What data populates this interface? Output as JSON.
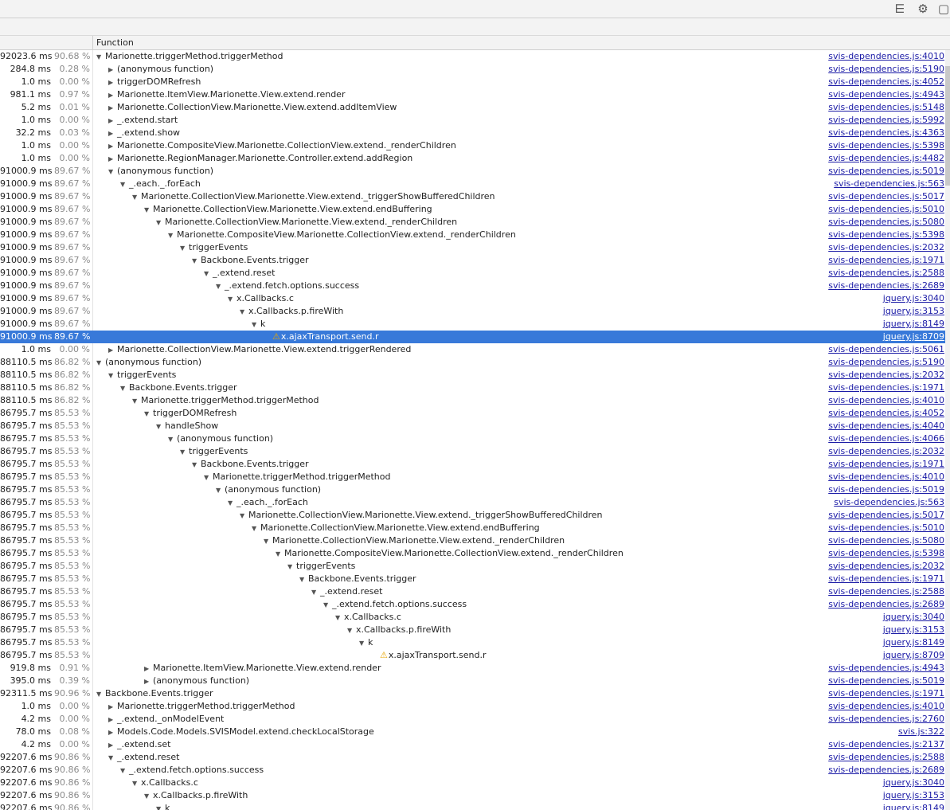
{
  "toolbar": {
    "icons": [
      "list-icon",
      "gear-icon",
      "dock-icon"
    ],
    "glyphs": [
      "⋿",
      "⚙",
      "▢"
    ]
  },
  "columns": {
    "function": "Function"
  },
  "rows": [
    {
      "self": "92023.6 ms",
      "pct": "90.68 %",
      "depth": 0,
      "expander": "open",
      "name": "Marionette.triggerMethod.triggerMethod",
      "url": "svis-dependencies.js:4010"
    },
    {
      "self": "284.8 ms",
      "pct": "0.28 %",
      "depth": 1,
      "expander": "closed",
      "name": "(anonymous function)",
      "url": "svis-dependencies.js:5190"
    },
    {
      "self": "1.0 ms",
      "pct": "0.00 %",
      "depth": 1,
      "expander": "closed",
      "name": "triggerDOMRefresh",
      "url": "svis-dependencies.js:4052"
    },
    {
      "self": "981.1 ms",
      "pct": "0.97 %",
      "depth": 1,
      "expander": "closed",
      "name": "Marionette.ItemView.Marionette.View.extend.render",
      "url": "svis-dependencies.js:4943"
    },
    {
      "self": "5.2 ms",
      "pct": "0.01 %",
      "depth": 1,
      "expander": "closed",
      "name": "Marionette.CollectionView.Marionette.View.extend.addItemView",
      "url": "svis-dependencies.js:5148"
    },
    {
      "self": "1.0 ms",
      "pct": "0.00 %",
      "depth": 1,
      "expander": "closed",
      "name": "_.extend.start",
      "url": "svis-dependencies.js:5992"
    },
    {
      "self": "32.2 ms",
      "pct": "0.03 %",
      "depth": 1,
      "expander": "closed",
      "name": "_.extend.show",
      "url": "svis-dependencies.js:4363"
    },
    {
      "self": "1.0 ms",
      "pct": "0.00 %",
      "depth": 1,
      "expander": "closed",
      "name": "Marionette.CompositeView.Marionette.CollectionView.extend._renderChildren",
      "url": "svis-dependencies.js:5398"
    },
    {
      "self": "1.0 ms",
      "pct": "0.00 %",
      "depth": 1,
      "expander": "closed",
      "name": "Marionette.RegionManager.Marionette.Controller.extend.addRegion",
      "url": "svis-dependencies.js:4482"
    },
    {
      "self": "91000.9 ms",
      "pct": "89.67 %",
      "depth": 1,
      "expander": "open",
      "name": "(anonymous function)",
      "url": "svis-dependencies.js:5019"
    },
    {
      "self": "91000.9 ms",
      "pct": "89.67 %",
      "depth": 2,
      "expander": "open",
      "name": "_.each._.forEach",
      "url": "svis-dependencies.js:563"
    },
    {
      "self": "91000.9 ms",
      "pct": "89.67 %",
      "depth": 3,
      "expander": "open",
      "name": "Marionette.CollectionView.Marionette.View.extend._triggerShowBufferedChildren",
      "url": "svis-dependencies.js:5017"
    },
    {
      "self": "91000.9 ms",
      "pct": "89.67 %",
      "depth": 4,
      "expander": "open",
      "name": "Marionette.CollectionView.Marionette.View.extend.endBuffering",
      "url": "svis-dependencies.js:5010"
    },
    {
      "self": "91000.9 ms",
      "pct": "89.67 %",
      "depth": 5,
      "expander": "open",
      "name": "Marionette.CollectionView.Marionette.View.extend._renderChildren",
      "url": "svis-dependencies.js:5080"
    },
    {
      "self": "91000.9 ms",
      "pct": "89.67 %",
      "depth": 6,
      "expander": "open",
      "name": "Marionette.CompositeView.Marionette.CollectionView.extend._renderChildren",
      "url": "svis-dependencies.js:5398"
    },
    {
      "self": "91000.9 ms",
      "pct": "89.67 %",
      "depth": 7,
      "expander": "open",
      "name": "triggerEvents",
      "url": "svis-dependencies.js:2032"
    },
    {
      "self": "91000.9 ms",
      "pct": "89.67 %",
      "depth": 8,
      "expander": "open",
      "name": "Backbone.Events.trigger",
      "url": "svis-dependencies.js:1971"
    },
    {
      "self": "91000.9 ms",
      "pct": "89.67 %",
      "depth": 9,
      "expander": "open",
      "name": "_.extend.reset",
      "url": "svis-dependencies.js:2588"
    },
    {
      "self": "91000.9 ms",
      "pct": "89.67 %",
      "depth": 10,
      "expander": "open",
      "name": "_.extend.fetch.options.success",
      "url": "svis-dependencies.js:2689"
    },
    {
      "self": "91000.9 ms",
      "pct": "89.67 %",
      "depth": 11,
      "expander": "open",
      "name": "x.Callbacks.c",
      "url": "jquery.js:3040"
    },
    {
      "self": "91000.9 ms",
      "pct": "89.67 %",
      "depth": 12,
      "expander": "open",
      "name": "x.Callbacks.p.fireWith",
      "url": "jquery.js:3153"
    },
    {
      "self": "91000.9 ms",
      "pct": "89.67 %",
      "depth": 13,
      "expander": "open",
      "name": "k",
      "url": "jquery.js:8149"
    },
    {
      "self": "91000.9 ms",
      "pct": "89.67 %",
      "depth": 14,
      "expander": "none",
      "warn": true,
      "selected": true,
      "name": "x.ajaxTransport.send.r",
      "url": "jquery.js:8709"
    },
    {
      "self": "1.0 ms",
      "pct": "0.00 %",
      "depth": 1,
      "expander": "closed",
      "name": "Marionette.CollectionView.Marionette.View.extend.triggerRendered",
      "url": "svis-dependencies.js:5061"
    },
    {
      "self": "88110.5 ms",
      "pct": "86.82 %",
      "depth": 0,
      "expander": "open",
      "name": "(anonymous function)",
      "url": "svis-dependencies.js:5190"
    },
    {
      "self": "88110.5 ms",
      "pct": "86.82 %",
      "depth": 1,
      "expander": "open",
      "name": "triggerEvents",
      "url": "svis-dependencies.js:2032"
    },
    {
      "self": "88110.5 ms",
      "pct": "86.82 %",
      "depth": 2,
      "expander": "open",
      "name": "Backbone.Events.trigger",
      "url": "svis-dependencies.js:1971"
    },
    {
      "self": "88110.5 ms",
      "pct": "86.82 %",
      "depth": 3,
      "expander": "open",
      "name": "Marionette.triggerMethod.triggerMethod",
      "url": "svis-dependencies.js:4010"
    },
    {
      "self": "86795.7 ms",
      "pct": "85.53 %",
      "depth": 4,
      "expander": "open",
      "name": "triggerDOMRefresh",
      "url": "svis-dependencies.js:4052"
    },
    {
      "self": "86795.7 ms",
      "pct": "85.53 %",
      "depth": 5,
      "expander": "open",
      "name": "handleShow",
      "url": "svis-dependencies.js:4040"
    },
    {
      "self": "86795.7 ms",
      "pct": "85.53 %",
      "depth": 6,
      "expander": "open",
      "name": "(anonymous function)",
      "url": "svis-dependencies.js:4066"
    },
    {
      "self": "86795.7 ms",
      "pct": "85.53 %",
      "depth": 7,
      "expander": "open",
      "name": "triggerEvents",
      "url": "svis-dependencies.js:2032"
    },
    {
      "self": "86795.7 ms",
      "pct": "85.53 %",
      "depth": 8,
      "expander": "open",
      "name": "Backbone.Events.trigger",
      "url": "svis-dependencies.js:1971"
    },
    {
      "self": "86795.7 ms",
      "pct": "85.53 %",
      "depth": 9,
      "expander": "open",
      "name": "Marionette.triggerMethod.triggerMethod",
      "url": "svis-dependencies.js:4010"
    },
    {
      "self": "86795.7 ms",
      "pct": "85.53 %",
      "depth": 10,
      "expander": "open",
      "name": "(anonymous function)",
      "url": "svis-dependencies.js:5019"
    },
    {
      "self": "86795.7 ms",
      "pct": "85.53 %",
      "depth": 11,
      "expander": "open",
      "name": "_.each._.forEach",
      "url": "svis-dependencies.js:563"
    },
    {
      "self": "86795.7 ms",
      "pct": "85.53 %",
      "depth": 12,
      "expander": "open",
      "name": "Marionette.CollectionView.Marionette.View.extend._triggerShowBufferedChildren",
      "url": "svis-dependencies.js:5017"
    },
    {
      "self": "86795.7 ms",
      "pct": "85.53 %",
      "depth": 13,
      "expander": "open",
      "name": "Marionette.CollectionView.Marionette.View.extend.endBuffering",
      "url": "svis-dependencies.js:5010"
    },
    {
      "self": "86795.7 ms",
      "pct": "85.53 %",
      "depth": 14,
      "expander": "open",
      "name": "Marionette.CollectionView.Marionette.View.extend._renderChildren",
      "url": "svis-dependencies.js:5080"
    },
    {
      "self": "86795.7 ms",
      "pct": "85.53 %",
      "depth": 15,
      "expander": "open",
      "name": "Marionette.CompositeView.Marionette.CollectionView.extend._renderChildren",
      "url": "svis-dependencies.js:5398"
    },
    {
      "self": "86795.7 ms",
      "pct": "85.53 %",
      "depth": 16,
      "expander": "open",
      "name": "triggerEvents",
      "url": "svis-dependencies.js:2032"
    },
    {
      "self": "86795.7 ms",
      "pct": "85.53 %",
      "depth": 17,
      "expander": "open",
      "name": "Backbone.Events.trigger",
      "url": "svis-dependencies.js:1971"
    },
    {
      "self": "86795.7 ms",
      "pct": "85.53 %",
      "depth": 18,
      "expander": "open",
      "name": "_.extend.reset",
      "url": "svis-dependencies.js:2588"
    },
    {
      "self": "86795.7 ms",
      "pct": "85.53 %",
      "depth": 19,
      "expander": "open",
      "name": "_.extend.fetch.options.success",
      "url": "svis-dependencies.js:2689"
    },
    {
      "self": "86795.7 ms",
      "pct": "85.53 %",
      "depth": 20,
      "expander": "open",
      "name": "x.Callbacks.c",
      "url": "jquery.js:3040"
    },
    {
      "self": "86795.7 ms",
      "pct": "85.53 %",
      "depth": 21,
      "expander": "open",
      "name": "x.Callbacks.p.fireWith",
      "url": "jquery.js:3153"
    },
    {
      "self": "86795.7 ms",
      "pct": "85.53 %",
      "depth": 22,
      "expander": "open",
      "name": "k",
      "url": "jquery.js:8149"
    },
    {
      "self": "86795.7 ms",
      "pct": "85.53 %",
      "depth": 23,
      "expander": "none",
      "warn": true,
      "name": "x.ajaxTransport.send.r",
      "url": "jquery.js:8709"
    },
    {
      "self": "919.8 ms",
      "pct": "0.91 %",
      "depth": 4,
      "expander": "closed",
      "name": "Marionette.ItemView.Marionette.View.extend.render",
      "url": "svis-dependencies.js:4943"
    },
    {
      "self": "395.0 ms",
      "pct": "0.39 %",
      "depth": 4,
      "expander": "closed",
      "name": "(anonymous function)",
      "url": "svis-dependencies.js:5019"
    },
    {
      "self": "92311.5 ms",
      "pct": "90.96 %",
      "depth": 0,
      "expander": "open",
      "name": "Backbone.Events.trigger",
      "url": "svis-dependencies.js:1971"
    },
    {
      "self": "1.0 ms",
      "pct": "0.00 %",
      "depth": 1,
      "expander": "closed",
      "name": "Marionette.triggerMethod.triggerMethod",
      "url": "svis-dependencies.js:4010"
    },
    {
      "self": "4.2 ms",
      "pct": "0.00 %",
      "depth": 1,
      "expander": "closed",
      "name": "_.extend._onModelEvent",
      "url": "svis-dependencies.js:2760"
    },
    {
      "self": "78.0 ms",
      "pct": "0.08 %",
      "depth": 1,
      "expander": "closed",
      "name": "Models.Code.Models.SVISModel.extend.checkLocalStorage",
      "url": "svis.js:322"
    },
    {
      "self": "4.2 ms",
      "pct": "0.00 %",
      "depth": 1,
      "expander": "closed",
      "name": "_.extend.set",
      "url": "svis-dependencies.js:2137"
    },
    {
      "self": "92207.6 ms",
      "pct": "90.86 %",
      "depth": 1,
      "expander": "open",
      "name": "_.extend.reset",
      "url": "svis-dependencies.js:2588"
    },
    {
      "self": "92207.6 ms",
      "pct": "90.86 %",
      "depth": 2,
      "expander": "open",
      "name": "_.extend.fetch.options.success",
      "url": "svis-dependencies.js:2689"
    },
    {
      "self": "92207.6 ms",
      "pct": "90.86 %",
      "depth": 3,
      "expander": "open",
      "name": "x.Callbacks.c",
      "url": "jquery.js:3040"
    },
    {
      "self": "92207.6 ms",
      "pct": "90.86 %",
      "depth": 4,
      "expander": "open",
      "name": "x.Callbacks.p.fireWith",
      "url": "jquery.js:3153"
    },
    {
      "self": "92207.6 ms",
      "pct": "90.86 %",
      "depth": 5,
      "expander": "open",
      "name": "k",
      "url": "jquery.js:8149"
    }
  ]
}
